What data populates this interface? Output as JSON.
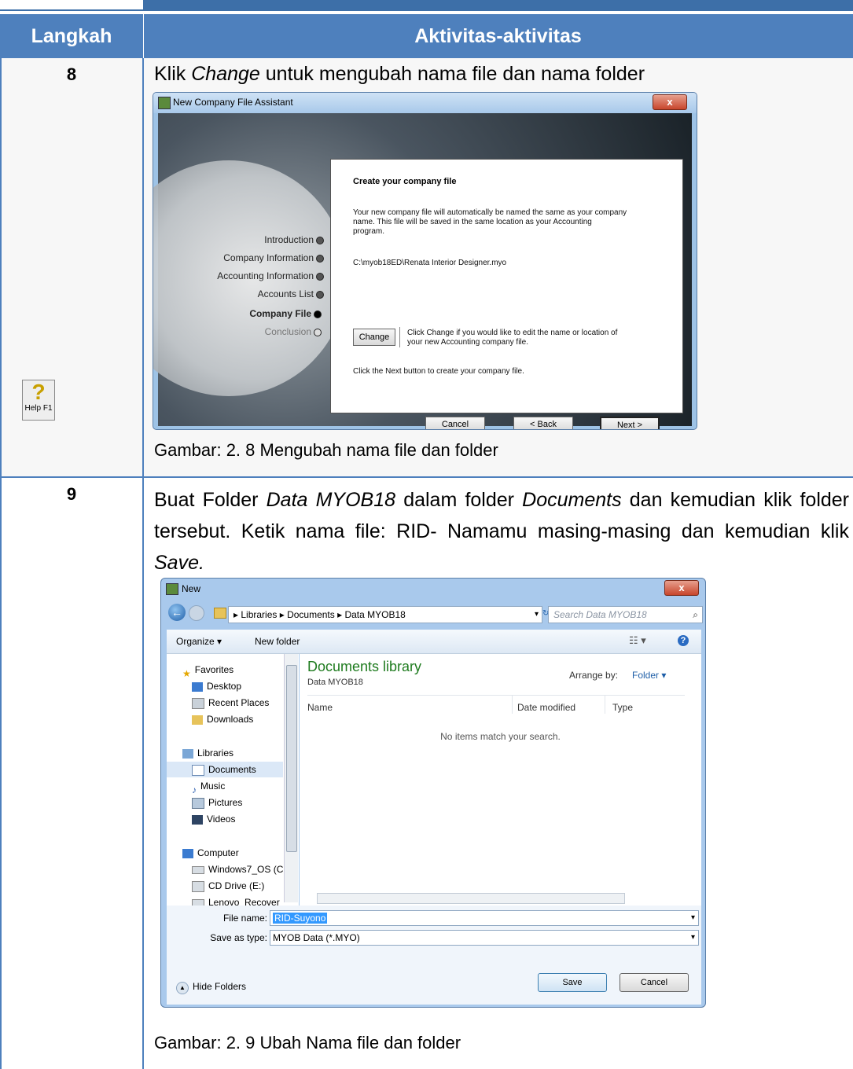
{
  "header": {
    "col1": "Langkah",
    "col2": "Aktivitas-aktivitas"
  },
  "rows": [
    {
      "step": "8",
      "text_before": "Klik ",
      "text_em": "Change",
      "text_after": " untuk mengubah nama file dan nama folder",
      "caption": "Gambar: 2. 8 Mengubah nama file dan folder"
    },
    {
      "step": "9",
      "p1": "Buat Folder ",
      "p1_em": "Data MYOB18",
      "p2": " dalam folder ",
      "p2_em": "Documents",
      "p3": " dan kemudian klik folder tersebut. Ketik nama file: RID- Namamu masing-masing dan kemudian klik ",
      "p3_em": "Save.",
      "caption": "Gambar: 2. 9 Ubah Nama file dan folder"
    }
  ],
  "wizard": {
    "title": "New Company File Assistant",
    "close": "x",
    "steps": [
      "Introduction",
      "Company Information",
      "Accounting Information",
      "Accounts List",
      "Company File",
      "Conclusion"
    ],
    "heading": "Create your company file",
    "desc1": "Your new company file will automatically be named the same as your company",
    "desc2": "name.  This file will be saved in the same location as your Accounting",
    "desc3": "program.",
    "path": "C:\\myob18ED\\Renata Interior Designer.myo",
    "change_btn": "Change",
    "change_desc1": "Click Change if you would like to edit the name or location of",
    "change_desc2": "your new Accounting company file.",
    "next_desc": "Click the Next button to create your company file.",
    "help": "Help F1",
    "cancel": "Cancel",
    "back": "< Back",
    "next": "Next >"
  },
  "dialog": {
    "title": "New",
    "close": "x",
    "breadcrumb": "▸ Libraries ▸ Documents ▸ Data MYOB18",
    "search_placeholder": "Search Data MYOB18",
    "organize": "Organize ▾",
    "new_folder": "New folder",
    "nav": {
      "favorites": "Favorites",
      "desktop": "Desktop",
      "recent": "Recent Places",
      "downloads": "Downloads",
      "libraries": "Libraries",
      "documents": "Documents",
      "music": "Music",
      "pictures": "Pictures",
      "videos": "Videos",
      "computer": "Computer",
      "windows": "Windows7_OS (C",
      "cd": "CD Drive (E:)",
      "lenovo": "Lenovo_Recover"
    },
    "library_title": "Documents library",
    "library_sub": "Data MYOB18",
    "arrange_by": "Arrange by:",
    "arrange_value": "Folder ▾",
    "col_name": "Name",
    "col_date": "Date modified",
    "col_type": "Type",
    "empty": "No items match your search.",
    "file_name_label": "File name:",
    "file_name_value": "RID-Suyono",
    "save_type_label": "Save as type:",
    "save_type_value": "MYOB Data (*.MYO)",
    "hide_folders": "Hide Folders",
    "save": "Save",
    "cancel": "Cancel"
  },
  "colors": {
    "header_bg": "#4e80bd",
    "accent_dark": "#3d6fa8",
    "library_title": "#1e7b1e"
  }
}
